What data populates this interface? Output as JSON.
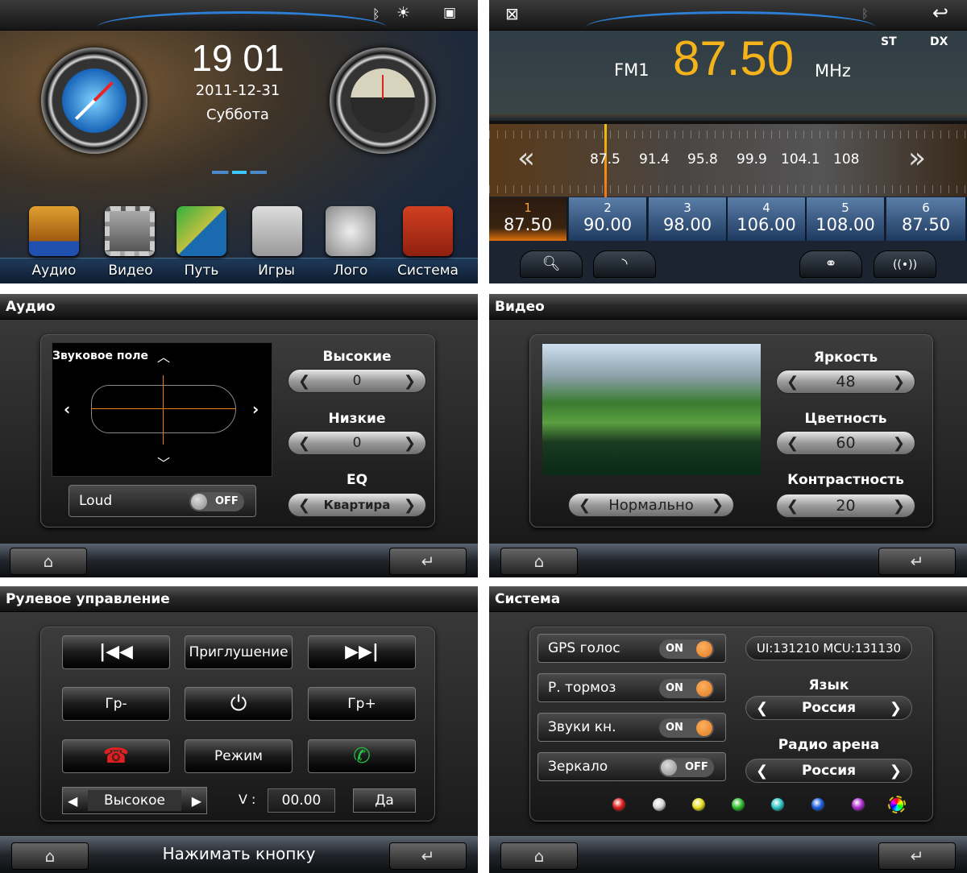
{
  "home": {
    "time": "19 01",
    "date": "2011-12-31",
    "weekday": "Суббота",
    "status_icons": [
      "bluetooth-icon",
      "brightness-icon",
      "gallery-icon"
    ],
    "dock": [
      {
        "label": "Аудио",
        "icon": "music-icon"
      },
      {
        "label": "Видео",
        "icon": "video-icon"
      },
      {
        "label": "Путь",
        "icon": "navigation-icon"
      },
      {
        "label": "Игры",
        "icon": "gamepad-icon"
      },
      {
        "label": "Лого",
        "icon": "car-icon"
      },
      {
        "label": "Система",
        "icon": "settings-icon"
      }
    ]
  },
  "radio": {
    "band": "FM1",
    "frequency": "87.50",
    "unit": "MHz",
    "st": "ST",
    "dx": "DX",
    "scale": [
      "87.5",
      "91.4",
      "95.8",
      "99.9",
      "104.1",
      "108"
    ],
    "presets": [
      {
        "n": "1",
        "f": "87.50"
      },
      {
        "n": "2",
        "f": "90.00"
      },
      {
        "n": "3",
        "f": "98.00"
      },
      {
        "n": "4",
        "f": "106.00"
      },
      {
        "n": "5",
        "f": "108.00"
      },
      {
        "n": "6",
        "f": "87.50"
      }
    ],
    "active_preset": 1,
    "accent": "#f5b31b",
    "buttons": [
      "search-icon",
      "rss-icon",
      "stereo-icon",
      "antenna-icon"
    ]
  },
  "audio": {
    "title": "Аудио",
    "sound_field": "Звуковое поле",
    "loud_label": "Loud",
    "loud_state": "OFF",
    "treble_label": "Высокие",
    "treble": "0",
    "bass_label": "Низкие",
    "bass": "0",
    "eq_label": "EQ",
    "eq": "Квартира"
  },
  "video": {
    "title": "Видео",
    "mode": "Нормально",
    "brightness_label": "Яркость",
    "brightness": "48",
    "color_label": "Цветность",
    "color": "60",
    "contrast_label": "Контрастность",
    "contrast": "20"
  },
  "steering": {
    "title": "Рулевое управление",
    "mute": "Приглушение",
    "group_minus": "Гр-",
    "group_plus": "Гр+",
    "mode": "Режим",
    "level": "Высокое",
    "v_label": "V :",
    "v_value": "00.00",
    "ok": "Да",
    "footer_text": "Нажимать кнопку"
  },
  "system": {
    "title": "Система",
    "version": "UI:131210 MCU:131130",
    "toggles": [
      {
        "label": "GPS голос",
        "state": "ON"
      },
      {
        "label": "Р. тормоз",
        "state": "ON"
      },
      {
        "label": "Звуки кн.",
        "state": "ON"
      },
      {
        "label": "Зеркало",
        "state": "OFF"
      }
    ],
    "language_label": "Язык",
    "language": "Россия",
    "region_label": "Радио арена",
    "region": "Россия",
    "theme_colors": [
      "#e02020",
      "#d8d8d8",
      "#e8e020",
      "#30c030",
      "#30c8c8",
      "#2060e0",
      "#b030d0",
      "multicolor"
    ],
    "selected_theme": 8
  }
}
